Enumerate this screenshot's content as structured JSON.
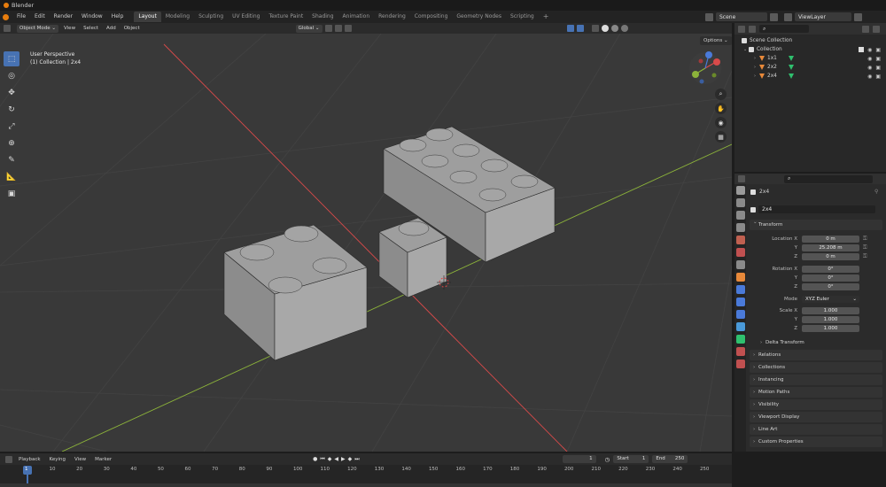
{
  "window": {
    "title": "Blender"
  },
  "menu": [
    "File",
    "Edit",
    "Render",
    "Window",
    "Help"
  ],
  "workspaces": [
    "Layout",
    "Modeling",
    "Sculpting",
    "UV Editing",
    "Texture Paint",
    "Shading",
    "Animation",
    "Rendering",
    "Compositing",
    "Geometry Nodes",
    "Scripting"
  ],
  "active_workspace": "Layout",
  "scene": "Scene",
  "view_layer": "ViewLayer",
  "viewport_header": {
    "mode": "Object Mode",
    "menus": [
      "View",
      "Select",
      "Add",
      "Object"
    ],
    "transform_orientation": "Global",
    "options": "Options"
  },
  "viewport_info": {
    "line1": "User Perspective",
    "line2": "(1) Collection | 2x4"
  },
  "outliner": {
    "root": "Scene Collection",
    "collection": "Collection",
    "objects": [
      "1x1",
      "2x2",
      "2x4"
    ]
  },
  "properties": {
    "object_name": "2x4",
    "data_name": "2x4",
    "transform_title": "Transform",
    "location_label": "Location X",
    "rotation_label": "Rotation X",
    "scale_label": "Scale X",
    "axis_y": "Y",
    "axis_z": "Z",
    "location": [
      "0 m",
      "25.208 m",
      "0 m"
    ],
    "rotation": [
      "0°",
      "0°",
      "0°"
    ],
    "mode_label": "Mode",
    "mode_value": "XYZ Euler",
    "scale": [
      "1.000",
      "1.000",
      "1.000"
    ],
    "delta_transform": "Delta Transform",
    "panels": [
      "Relations",
      "Collections",
      "Instancing",
      "Motion Paths",
      "Visibility",
      "Viewport Display",
      "Line Art",
      "Custom Properties"
    ]
  },
  "timeline": {
    "menus": [
      "Playback",
      "Keying",
      "View",
      "Marker"
    ],
    "current_frame": "1",
    "start_label": "Start",
    "start": "1",
    "end_label": "End",
    "end": "250",
    "ticks": [
      "1",
      "10",
      "20",
      "30",
      "40",
      "50",
      "60",
      "70",
      "80",
      "90",
      "100",
      "110",
      "120",
      "130",
      "140",
      "150",
      "160",
      "170",
      "180",
      "190",
      "200",
      "210",
      "220",
      "230",
      "240",
      "250"
    ]
  },
  "colors": {
    "accent": "#4772b3",
    "x_axis": "#d94a4a",
    "y_axis": "#8cb33a",
    "object_orange": "#e8893a",
    "mesh_green": "#2fc06e"
  }
}
